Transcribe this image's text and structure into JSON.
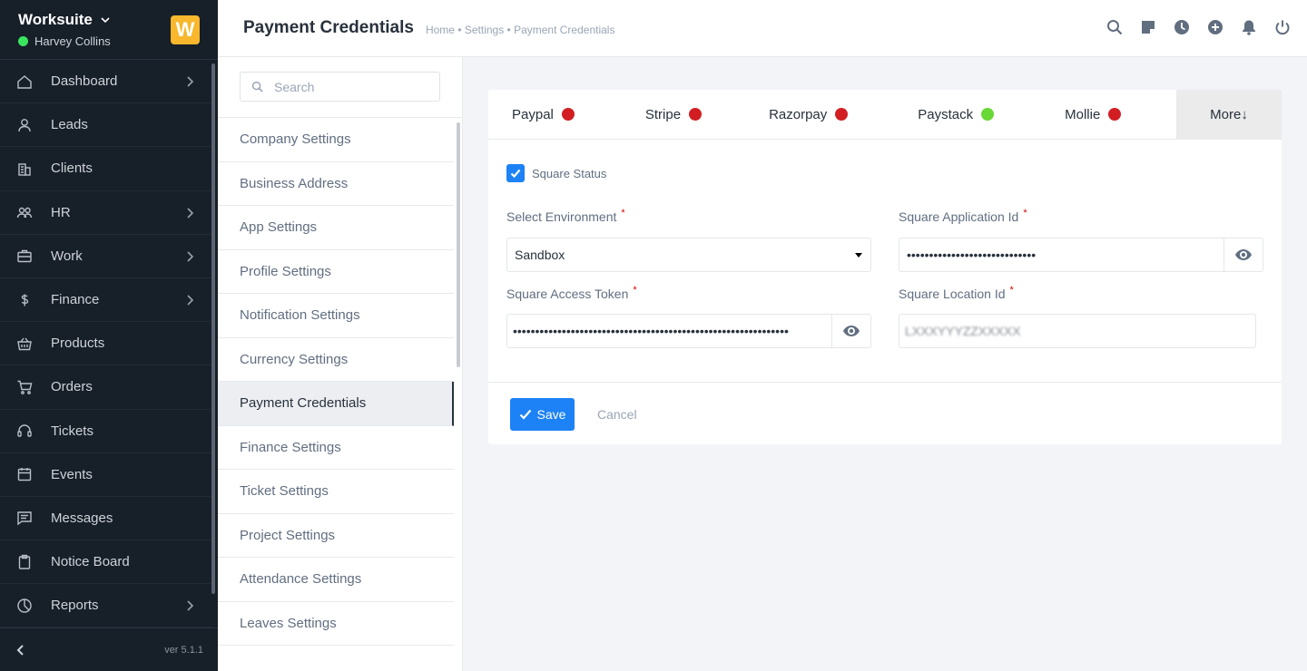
{
  "app": {
    "name": "Worksuite",
    "user": "Harvey Collins",
    "logo_letter": "W",
    "version": "ver 5.1.1"
  },
  "sidebar": {
    "items": [
      {
        "label": "Dashboard",
        "icon": "home-icon",
        "chevron": true
      },
      {
        "label": "Leads",
        "icon": "person-icon",
        "chevron": false
      },
      {
        "label": "Clients",
        "icon": "building-icon",
        "chevron": false
      },
      {
        "label": "HR",
        "icon": "people-icon",
        "chevron": true
      },
      {
        "label": "Work",
        "icon": "briefcase-icon",
        "chevron": true
      },
      {
        "label": "Finance",
        "icon": "dollar-icon",
        "chevron": true
      },
      {
        "label": "Products",
        "icon": "basket-icon",
        "chevron": false
      },
      {
        "label": "Orders",
        "icon": "cart-icon",
        "chevron": false
      },
      {
        "label": "Tickets",
        "icon": "headset-icon",
        "chevron": false
      },
      {
        "label": "Events",
        "icon": "calendar-icon",
        "chevron": false
      },
      {
        "label": "Messages",
        "icon": "message-icon",
        "chevron": false
      },
      {
        "label": "Notice Board",
        "icon": "clipboard-icon",
        "chevron": false
      },
      {
        "label": "Reports",
        "icon": "pie-chart-icon",
        "chevron": true
      }
    ]
  },
  "header": {
    "title": "Payment Credentials",
    "breadcrumb": "Home • Settings • Payment Credentials"
  },
  "settings_menu": {
    "search_placeholder": "Search",
    "items": [
      "Company Settings",
      "Business Address",
      "App Settings",
      "Profile Settings",
      "Notification Settings",
      "Currency Settings",
      "Payment Credentials",
      "Finance Settings",
      "Ticket Settings",
      "Project Settings",
      "Attendance Settings",
      "Leaves Settings"
    ],
    "active": "Payment Credentials"
  },
  "gateways": {
    "tabs": [
      {
        "label": "Paypal",
        "status_color": "#d21e23"
      },
      {
        "label": "Stripe",
        "status_color": "#d21e23"
      },
      {
        "label": "Razorpay",
        "status_color": "#d21e23"
      },
      {
        "label": "Paystack",
        "status_color": "#67d835"
      },
      {
        "label": "Mollie",
        "status_color": "#d21e23"
      }
    ],
    "more_label": "More↓"
  },
  "form": {
    "status_label": "Square Status",
    "status_checked": true,
    "environment_label": "Select Environment",
    "environment_value": "Sandbox",
    "app_id_label": "Square Application Id",
    "app_id_value": "•••••••••••••••••••••••••••••",
    "access_token_label": "Square Access Token",
    "access_token_value": "••••••••••••••••••••••••••••••••••••••••••••••••••••••••••••••",
    "location_id_label": "Square Location Id",
    "location_id_value": "LXXXYYYZZXXXXX",
    "required_mark": "*"
  },
  "actions": {
    "save": "Save",
    "cancel": "Cancel"
  },
  "colors": {
    "accent": "#1d82f5",
    "sidebar_bg": "#171f29",
    "error": "#d21e23",
    "success": "#67d835"
  }
}
